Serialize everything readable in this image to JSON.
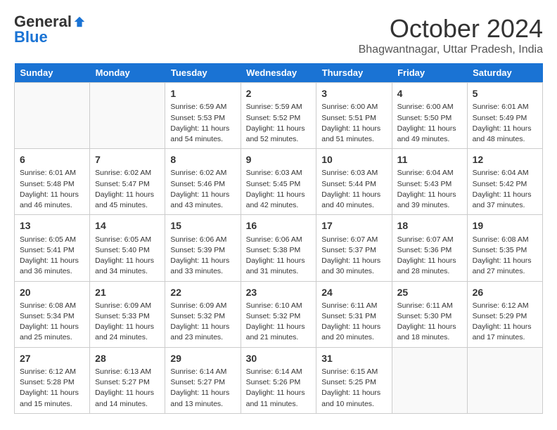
{
  "header": {
    "logo_general": "General",
    "logo_blue": "Blue",
    "month": "October 2024",
    "location": "Bhagwantnagar, Uttar Pradesh, India"
  },
  "days_of_week": [
    "Sunday",
    "Monday",
    "Tuesday",
    "Wednesday",
    "Thursday",
    "Friday",
    "Saturday"
  ],
  "weeks": [
    [
      {
        "day": "",
        "empty": true
      },
      {
        "day": "",
        "empty": true
      },
      {
        "day": "1",
        "sunrise": "6:59 AM",
        "sunset": "5:53 PM",
        "daylight": "11 hours and 54 minutes."
      },
      {
        "day": "2",
        "sunrise": "5:59 AM",
        "sunset": "5:52 PM",
        "daylight": "11 hours and 52 minutes."
      },
      {
        "day": "3",
        "sunrise": "6:00 AM",
        "sunset": "5:51 PM",
        "daylight": "11 hours and 51 minutes."
      },
      {
        "day": "4",
        "sunrise": "6:00 AM",
        "sunset": "5:50 PM",
        "daylight": "11 hours and 49 minutes."
      },
      {
        "day": "5",
        "sunrise": "6:01 AM",
        "sunset": "5:49 PM",
        "daylight": "11 hours and 48 minutes."
      }
    ],
    [
      {
        "day": "6",
        "sunrise": "6:01 AM",
        "sunset": "5:48 PM",
        "daylight": "11 hours and 46 minutes."
      },
      {
        "day": "7",
        "sunrise": "6:02 AM",
        "sunset": "5:47 PM",
        "daylight": "11 hours and 45 minutes."
      },
      {
        "day": "8",
        "sunrise": "6:02 AM",
        "sunset": "5:46 PM",
        "daylight": "11 hours and 43 minutes."
      },
      {
        "day": "9",
        "sunrise": "6:03 AM",
        "sunset": "5:45 PM",
        "daylight": "11 hours and 42 minutes."
      },
      {
        "day": "10",
        "sunrise": "6:03 AM",
        "sunset": "5:44 PM",
        "daylight": "11 hours and 40 minutes."
      },
      {
        "day": "11",
        "sunrise": "6:04 AM",
        "sunset": "5:43 PM",
        "daylight": "11 hours and 39 minutes."
      },
      {
        "day": "12",
        "sunrise": "6:04 AM",
        "sunset": "5:42 PM",
        "daylight": "11 hours and 37 minutes."
      }
    ],
    [
      {
        "day": "13",
        "sunrise": "6:05 AM",
        "sunset": "5:41 PM",
        "daylight": "11 hours and 36 minutes."
      },
      {
        "day": "14",
        "sunrise": "6:05 AM",
        "sunset": "5:40 PM",
        "daylight": "11 hours and 34 minutes."
      },
      {
        "day": "15",
        "sunrise": "6:06 AM",
        "sunset": "5:39 PM",
        "daylight": "11 hours and 33 minutes."
      },
      {
        "day": "16",
        "sunrise": "6:06 AM",
        "sunset": "5:38 PM",
        "daylight": "11 hours and 31 minutes."
      },
      {
        "day": "17",
        "sunrise": "6:07 AM",
        "sunset": "5:37 PM",
        "daylight": "11 hours and 30 minutes."
      },
      {
        "day": "18",
        "sunrise": "6:07 AM",
        "sunset": "5:36 PM",
        "daylight": "11 hours and 28 minutes."
      },
      {
        "day": "19",
        "sunrise": "6:08 AM",
        "sunset": "5:35 PM",
        "daylight": "11 hours and 27 minutes."
      }
    ],
    [
      {
        "day": "20",
        "sunrise": "6:08 AM",
        "sunset": "5:34 PM",
        "daylight": "11 hours and 25 minutes."
      },
      {
        "day": "21",
        "sunrise": "6:09 AM",
        "sunset": "5:33 PM",
        "daylight": "11 hours and 24 minutes."
      },
      {
        "day": "22",
        "sunrise": "6:09 AM",
        "sunset": "5:32 PM",
        "daylight": "11 hours and 23 minutes."
      },
      {
        "day": "23",
        "sunrise": "6:10 AM",
        "sunset": "5:32 PM",
        "daylight": "11 hours and 21 minutes."
      },
      {
        "day": "24",
        "sunrise": "6:11 AM",
        "sunset": "5:31 PM",
        "daylight": "11 hours and 20 minutes."
      },
      {
        "day": "25",
        "sunrise": "6:11 AM",
        "sunset": "5:30 PM",
        "daylight": "11 hours and 18 minutes."
      },
      {
        "day": "26",
        "sunrise": "6:12 AM",
        "sunset": "5:29 PM",
        "daylight": "11 hours and 17 minutes."
      }
    ],
    [
      {
        "day": "27",
        "sunrise": "6:12 AM",
        "sunset": "5:28 PM",
        "daylight": "11 hours and 15 minutes."
      },
      {
        "day": "28",
        "sunrise": "6:13 AM",
        "sunset": "5:27 PM",
        "daylight": "11 hours and 14 minutes."
      },
      {
        "day": "29",
        "sunrise": "6:14 AM",
        "sunset": "5:27 PM",
        "daylight": "11 hours and 13 minutes."
      },
      {
        "day": "30",
        "sunrise": "6:14 AM",
        "sunset": "5:26 PM",
        "daylight": "11 hours and 11 minutes."
      },
      {
        "day": "31",
        "sunrise": "6:15 AM",
        "sunset": "5:25 PM",
        "daylight": "11 hours and 10 minutes."
      },
      {
        "day": "",
        "empty": true
      },
      {
        "day": "",
        "empty": true
      }
    ]
  ],
  "labels": {
    "sunrise": "Sunrise:",
    "sunset": "Sunset:",
    "daylight": "Daylight:"
  }
}
